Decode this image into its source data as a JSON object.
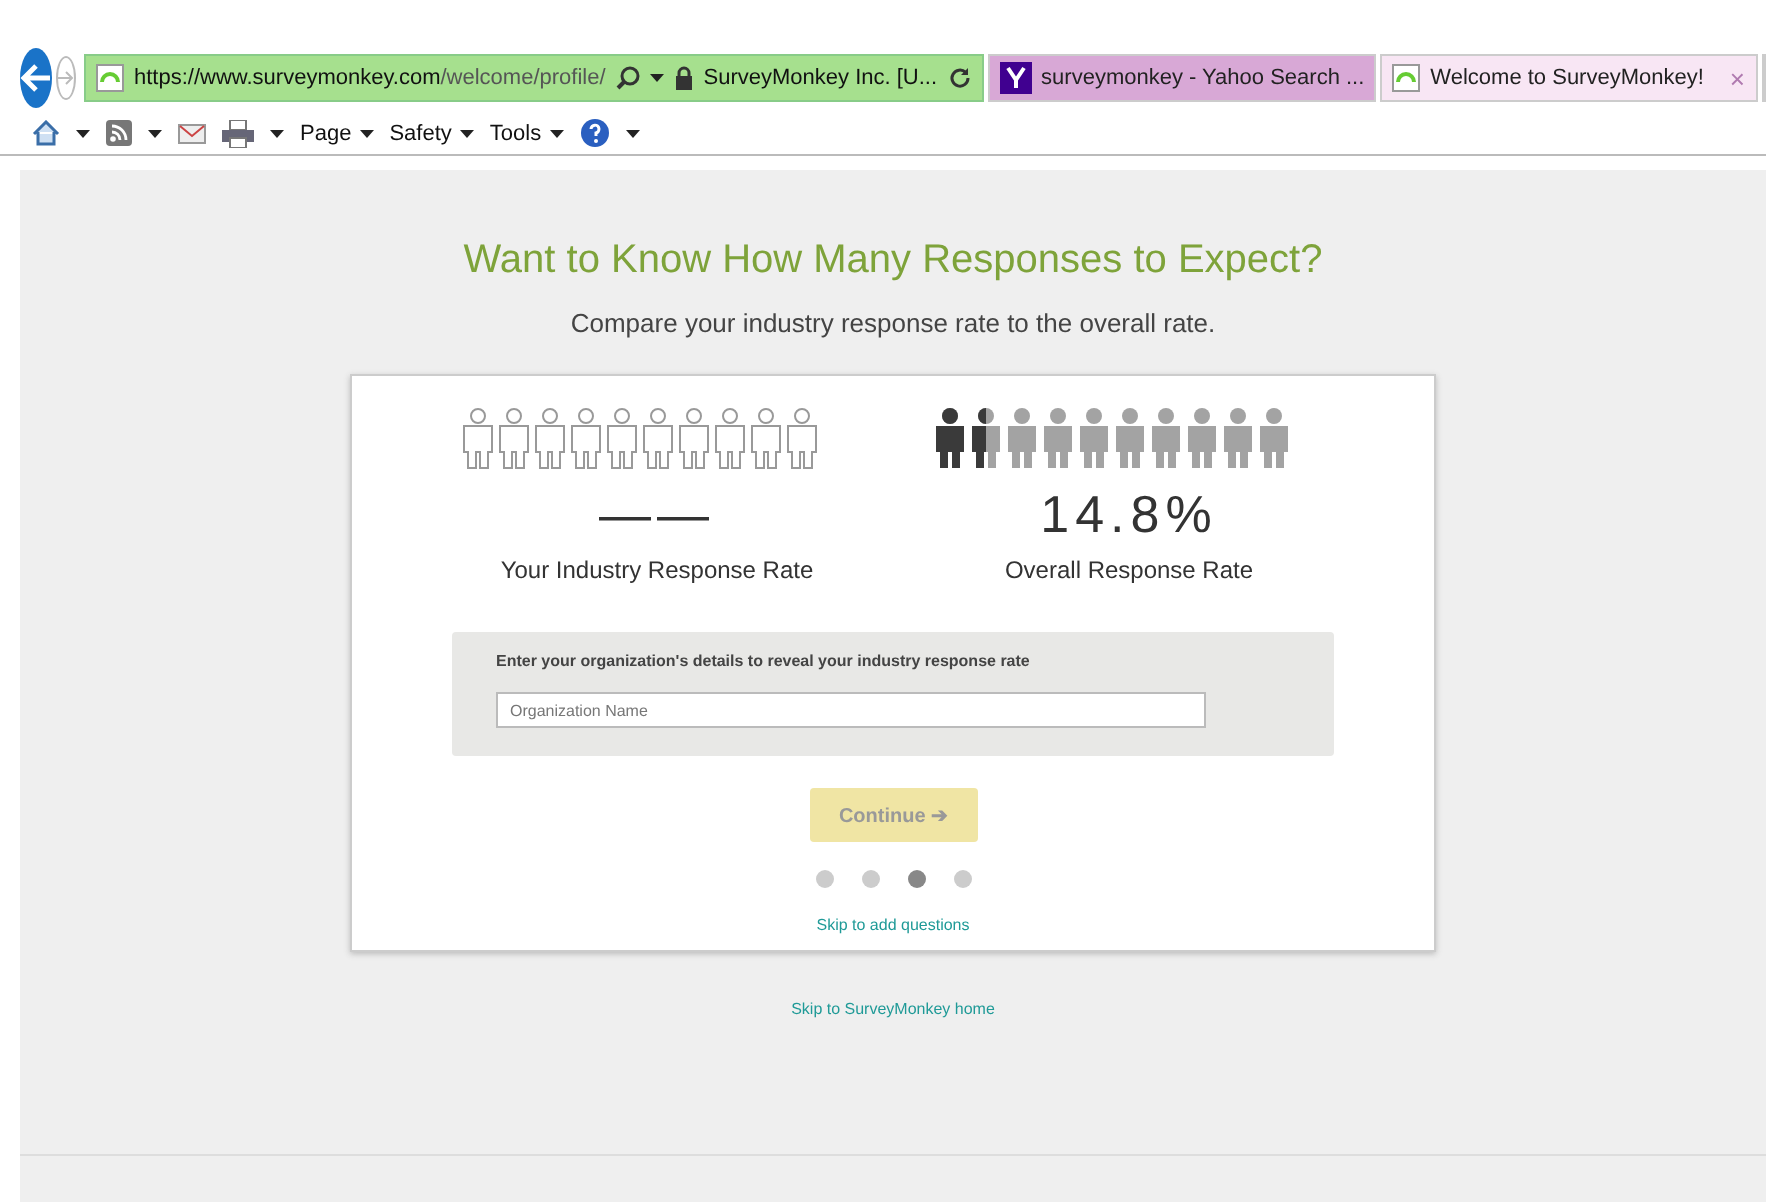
{
  "address_bar": {
    "url_host": "https://www.surveymonkey.com",
    "url_path": "/welcome/profile/",
    "site_identity": "SurveyMonkey Inc. [U..."
  },
  "tabs": [
    {
      "label": "surveymonkey - Yahoo Search ...",
      "selected": false,
      "kind": "yahoo"
    },
    {
      "label": "Welcome to SurveyMonkey!",
      "selected": true,
      "kind": "site",
      "close": "×"
    }
  ],
  "command_bar": [
    "Page",
    "Safety",
    "Tools"
  ],
  "page": {
    "heading": "Want to Know How Many Responses to Expect?",
    "subheading": "Compare your industry response rate to the overall rate.",
    "rates": [
      {
        "kind": "outline",
        "value": "——",
        "label": "Your Industry Response Rate"
      },
      {
        "kind": "filled",
        "value": "14.8%",
        "label": "Overall Response Rate"
      }
    ],
    "form": {
      "prompt": "Enter your organization's details to reveal your industry response rate",
      "placeholder": "Organization Name"
    },
    "continue_button": {
      "label": "Continue ➔",
      "disabled": true
    },
    "steps": [
      {
        "selected": false
      },
      {
        "selected": false
      },
      {
        "selected": true
      },
      {
        "selected": false
      }
    ],
    "skip_link": "Skip to add questions",
    "home_link": "Skip to SurveyMonkey home"
  }
}
